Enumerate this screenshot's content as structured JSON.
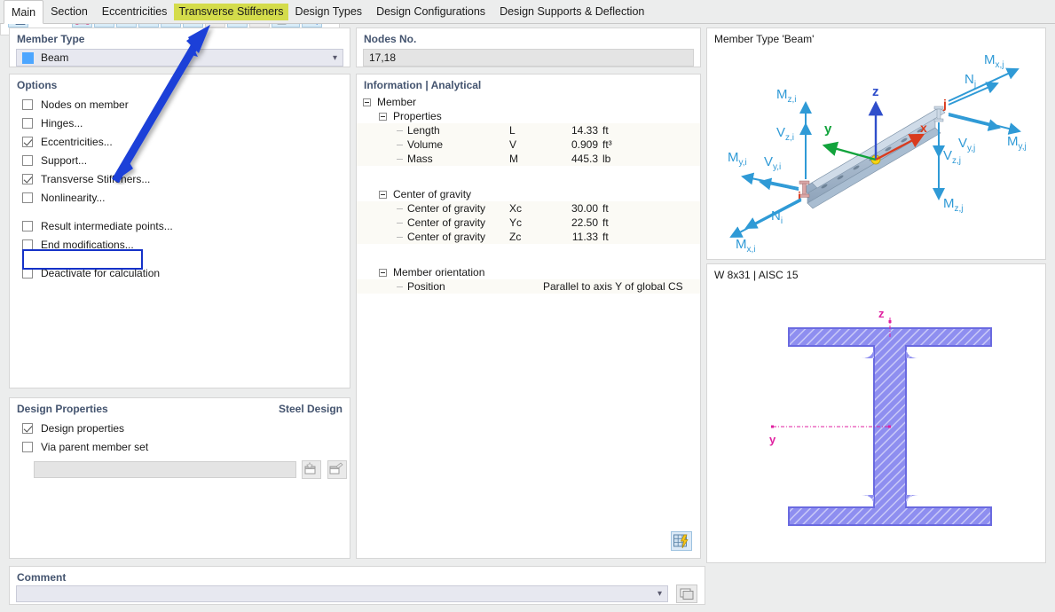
{
  "tabs": [
    {
      "label": "Main",
      "state": "active"
    },
    {
      "label": "Section",
      "state": "normal"
    },
    {
      "label": "Eccentricities",
      "state": "normal"
    },
    {
      "label": "Transverse Stiffeners",
      "state": "highlight"
    },
    {
      "label": "Design Types",
      "state": "normal"
    },
    {
      "label": "Design Configurations",
      "state": "normal"
    },
    {
      "label": "Design Supports & Deflection",
      "state": "normal"
    }
  ],
  "member_type": {
    "title": "Member Type",
    "value": "Beam",
    "swatch_color": "#4da6ff",
    "caret_icon": "chevron-down-icon"
  },
  "options": {
    "title": "Options",
    "items": [
      {
        "label": "Nodes on member",
        "checked": false
      },
      {
        "label": "Hinges...",
        "checked": false
      },
      {
        "label": "Eccentricities...",
        "checked": true
      },
      {
        "label": "Support...",
        "checked": false
      },
      {
        "label": "Transverse Stiffeners...",
        "checked": true,
        "highlighted": true
      },
      {
        "label": "Nonlinearity...",
        "checked": false
      },
      {
        "label": "Result intermediate points...",
        "checked": false
      },
      {
        "label": "End modifications...",
        "checked": false
      },
      {
        "label": "Deactivate for calculation",
        "checked": false
      }
    ],
    "highlight_color": "#1532c8"
  },
  "design_properties": {
    "title": "Design Properties",
    "title_right": "Steel Design",
    "items": [
      {
        "label": "Design properties",
        "checked": true
      },
      {
        "label": "Via parent member set",
        "checked": false
      }
    ],
    "input_value": "",
    "buttons": [
      "new-item-icon",
      "edit-item-icon"
    ]
  },
  "comment": {
    "title": "Comment",
    "value": "",
    "caret_icon": "chevron-down-icon",
    "button_icon": "copy-icon"
  },
  "nodes": {
    "title": "Nodes No.",
    "value": "17,18"
  },
  "information": {
    "title": "Information | Analytical",
    "root": "Member",
    "groups": [
      {
        "name": "Properties",
        "rows": [
          {
            "label": "Length",
            "symbol": "L",
            "value": "14.33",
            "unit": "ft"
          },
          {
            "label": "Volume",
            "symbol": "V",
            "value": "0.909",
            "unit": "ft³"
          },
          {
            "label": "Mass",
            "symbol": "M",
            "value": "445.3",
            "unit": "lb"
          }
        ]
      },
      {
        "name": "Center of gravity",
        "rows": [
          {
            "label": "Center of gravity",
            "symbol": "Xc",
            "value": "30.00",
            "unit": "ft"
          },
          {
            "label": "Center of gravity",
            "symbol": "Yc",
            "value": "22.50",
            "unit": "ft"
          },
          {
            "label": "Center of gravity",
            "symbol": "Zc",
            "value": "11.33",
            "unit": "ft"
          }
        ]
      },
      {
        "name": "Member orientation",
        "rows": [
          {
            "label": "Position",
            "symbol": "",
            "long_value": "Parallel to axis Y of global CS",
            "unit": ""
          }
        ]
      }
    ],
    "bottom_button_icon": "table-lightning-icon"
  },
  "beam_view": {
    "caption": "Member Type 'Beam'",
    "axes": [
      {
        "name": "x",
        "color": "#d93b1e"
      },
      {
        "name": "y",
        "color": "#12a33c"
      },
      {
        "name": "z",
        "color": "#2f4ecb"
      }
    ],
    "node_labels": [
      "i",
      "j"
    ],
    "force_labels": [
      "M_z,i",
      "V_z,i",
      "M_y,i",
      "V_y,i",
      "N_i",
      "M_x,i",
      "N_j",
      "M_x,j",
      "V_y,j",
      "M_y,j",
      "V_z,j",
      "M_z,j"
    ],
    "arrow_color": "#2f9ad6"
  },
  "section_view": {
    "caption": "W 8x31 | AISC 15",
    "axis_labels": [
      "z",
      "y"
    ],
    "section_color": "#7b7be8",
    "axis_color": "#e020a0"
  },
  "toolbar": {
    "buttons": [
      {
        "name": "render-view-icon",
        "style": "active"
      },
      {
        "name": "section-outline-icon",
        "style": "active"
      },
      {
        "name": "dimensions-icon",
        "style": "active"
      },
      {
        "name": "local-axes-icon",
        "style": "active"
      },
      {
        "name": "centroid-icon",
        "style": "active"
      },
      {
        "name": "stress-points-icon",
        "style": "active"
      },
      {
        "name": "section-shape-icon",
        "style": "active"
      },
      {
        "name": "numbering-icon",
        "style": "flat"
      },
      {
        "name": "grid-icon",
        "style": "active"
      },
      {
        "name": "table-icon",
        "style": "flat"
      },
      {
        "name": "print-icon",
        "style": "active"
      },
      {
        "name": "clear-selection-icon",
        "style": "active"
      }
    ]
  }
}
